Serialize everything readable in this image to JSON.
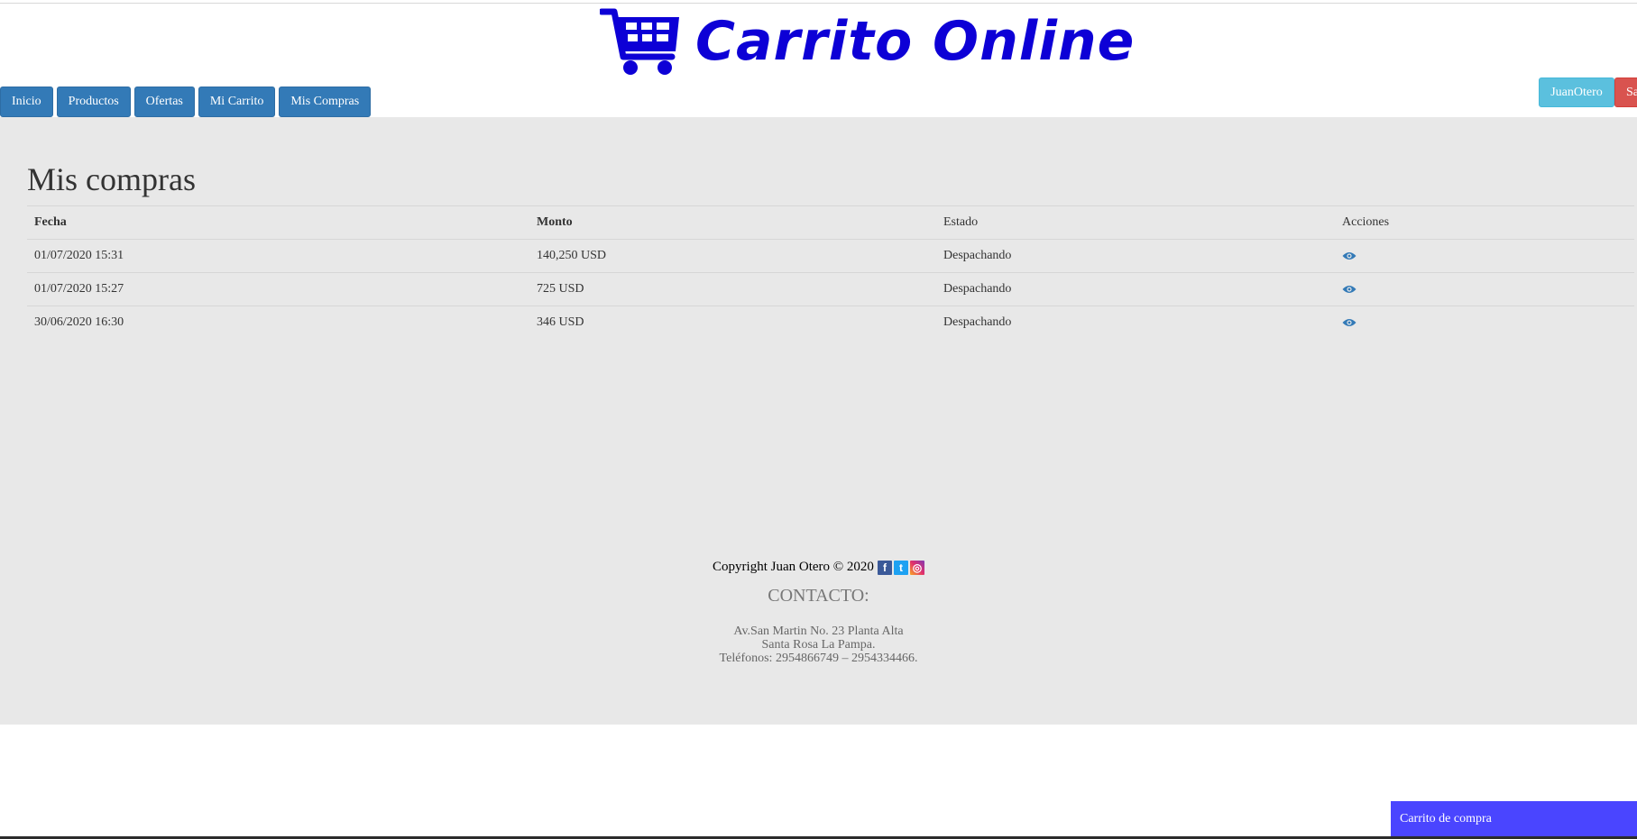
{
  "brand": {
    "title": "Carrito Online"
  },
  "nav": {
    "items": [
      "Inicio",
      "Productos",
      "Ofertas",
      "Mi Carrito",
      "Mis Compras"
    ]
  },
  "user": {
    "name": "JuanOtero",
    "logout_label": "Sa"
  },
  "page": {
    "title": "Mis compras"
  },
  "table": {
    "headers": {
      "fecha": "Fecha",
      "monto": "Monto",
      "estado": "Estado",
      "acciones": "Acciones"
    },
    "rows": [
      {
        "fecha": "01/07/2020 15:31",
        "monto": "140,250 USD",
        "estado": "Despachando",
        "action_icon": "eye-icon"
      },
      {
        "fecha": "01/07/2020 15:27",
        "monto": "725 USD",
        "estado": "Despachando",
        "action_icon": "eye-icon"
      },
      {
        "fecha": "30/06/2020 16:30",
        "monto": "346 USD",
        "estado": "Despachando",
        "action_icon": "eye-icon"
      }
    ]
  },
  "footer": {
    "copyright": "Copyright Juan Otero © 2020",
    "social_icons": [
      "facebook-icon",
      "twitter-icon",
      "instagram-icon"
    ],
    "contact_title": "CONTACTO:",
    "address_line1": "Av.San Martin No. 23 Planta Alta",
    "address_line2": "Santa Rosa La Pampa.",
    "phones": "Teléfonos: 2954866749 – 2954334466."
  },
  "cart_panel": {
    "label": "Carrito de compra"
  },
  "colors": {
    "brand": "#0d00d6",
    "primary": "#337ab7",
    "info": "#5bc0de",
    "danger": "#d9534f",
    "cart_panel": "#4a45ff",
    "main_bg": "#e8e8e8"
  }
}
